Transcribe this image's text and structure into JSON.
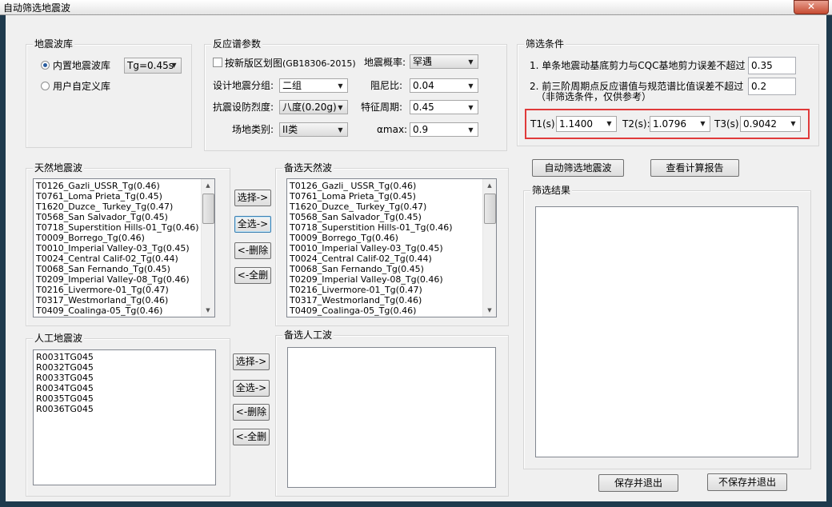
{
  "window": {
    "title": "自动筛选地震波",
    "close": "✕"
  },
  "library": {
    "title": "地震波库",
    "builtin_label": "内置地震波库",
    "custom_label": "用户自定义库",
    "tg_value": "Tg=0.45s"
  },
  "spectrum": {
    "title": "反应谱参数",
    "new_zoning_label": "按新版区划图",
    "new_zoning_note": "(GB18306-2015)",
    "design_group_label": "设计地震分组:",
    "design_group_value": "二组",
    "intensity_label": "抗震设防烈度:",
    "intensity_value": "八度(0.20g)",
    "site_label": "场地类别:",
    "site_value": "II类",
    "prob_label": "地震概率:",
    "prob_value": "罕遇",
    "damping_label": "阻尼比:",
    "damping_value": "0.04",
    "period_label": "特征周期:",
    "period_value": "0.45",
    "amax_label": "αmax:",
    "amax_value": "0.9"
  },
  "criteria": {
    "title": "筛选条件",
    "c1_label": "1. 单条地震动基底剪力与CQC基地剪力误差不超过",
    "c1_value": "0.35",
    "c2_label": "2. 前三阶周期点反应谱值与规范谱比值误差不超过",
    "c2_note": "（非筛选条件，仅供参考）",
    "c2_value": "0.2",
    "t1_label": "T1(s):",
    "t1_value": "1.1400",
    "t2_label": "T2(s):",
    "t2_value": "1.0796",
    "t3_label": "T3(s):",
    "t3_value": "0.9042"
  },
  "natural": {
    "title": "天然地震波",
    "items": [
      "T0126_Gazli_USSR_Tg(0.46)",
      "T0761_Loma Prieta_Tg(0.45)",
      "T1620_Duzce_ Turkey_Tg(0.47)",
      "T0568_San Salvador_Tg(0.45)",
      "T0718_Superstition Hills-01_Tg(0.46)",
      "T0009_Borrego_Tg(0.46)",
      "T0010_Imperial Valley-03_Tg(0.45)",
      "T0024_Central Calif-02_Tg(0.44)",
      "T0068_San Fernando_Tg(0.45)",
      "T0209_Imperial Valley-08_Tg(0.46)",
      "T0216_Livermore-01_Tg(0.47)",
      "T0317_Westmorland_Tg(0.46)",
      "T0409_Coalinga-05_Tg(0.46)"
    ]
  },
  "candidate_natural": {
    "title": "备选天然波",
    "items": [
      "T0126_Gazli_ USSR_Tg(0.46)",
      "T0761_Loma Prieta_Tg(0.45)",
      "T1620_Duzce_ Turkey_Tg(0.47)",
      "T0568_San Salvador_Tg(0.45)",
      "T0718_Superstition Hills-01_Tg(0.46)",
      "T0009_Borrego_Tg(0.46)",
      "T0010_Imperial Valley-03_Tg(0.45)",
      "T0024_Central Calif-02_Tg(0.44)",
      "T0068_San Fernando_Tg(0.45)",
      "T0209_Imperial Valley-08_Tg(0.46)",
      "T0216_Livermore-01_Tg(0.47)",
      "T0317_Westmorland_Tg(0.46)",
      "T0409_Coalinga-05_Tg(0.46)"
    ]
  },
  "artificial": {
    "title": "人工地震波",
    "items": [
      "R0031TG045",
      "R0032TG045",
      "R0033TG045",
      "R0034TG045",
      "R0035TG045",
      "R0036TG045"
    ]
  },
  "candidate_artificial": {
    "title": "备选人工波"
  },
  "buttons": {
    "select": "选择->",
    "select_all": "全选->",
    "delete": "<-删除",
    "delete_all": "<-全删",
    "auto_filter": "自动筛选地震波",
    "view_report": "查看计算报告",
    "save_exit": "保存并退出",
    "nosave_exit": "不保存并退出"
  },
  "results": {
    "title": "筛选结果"
  }
}
